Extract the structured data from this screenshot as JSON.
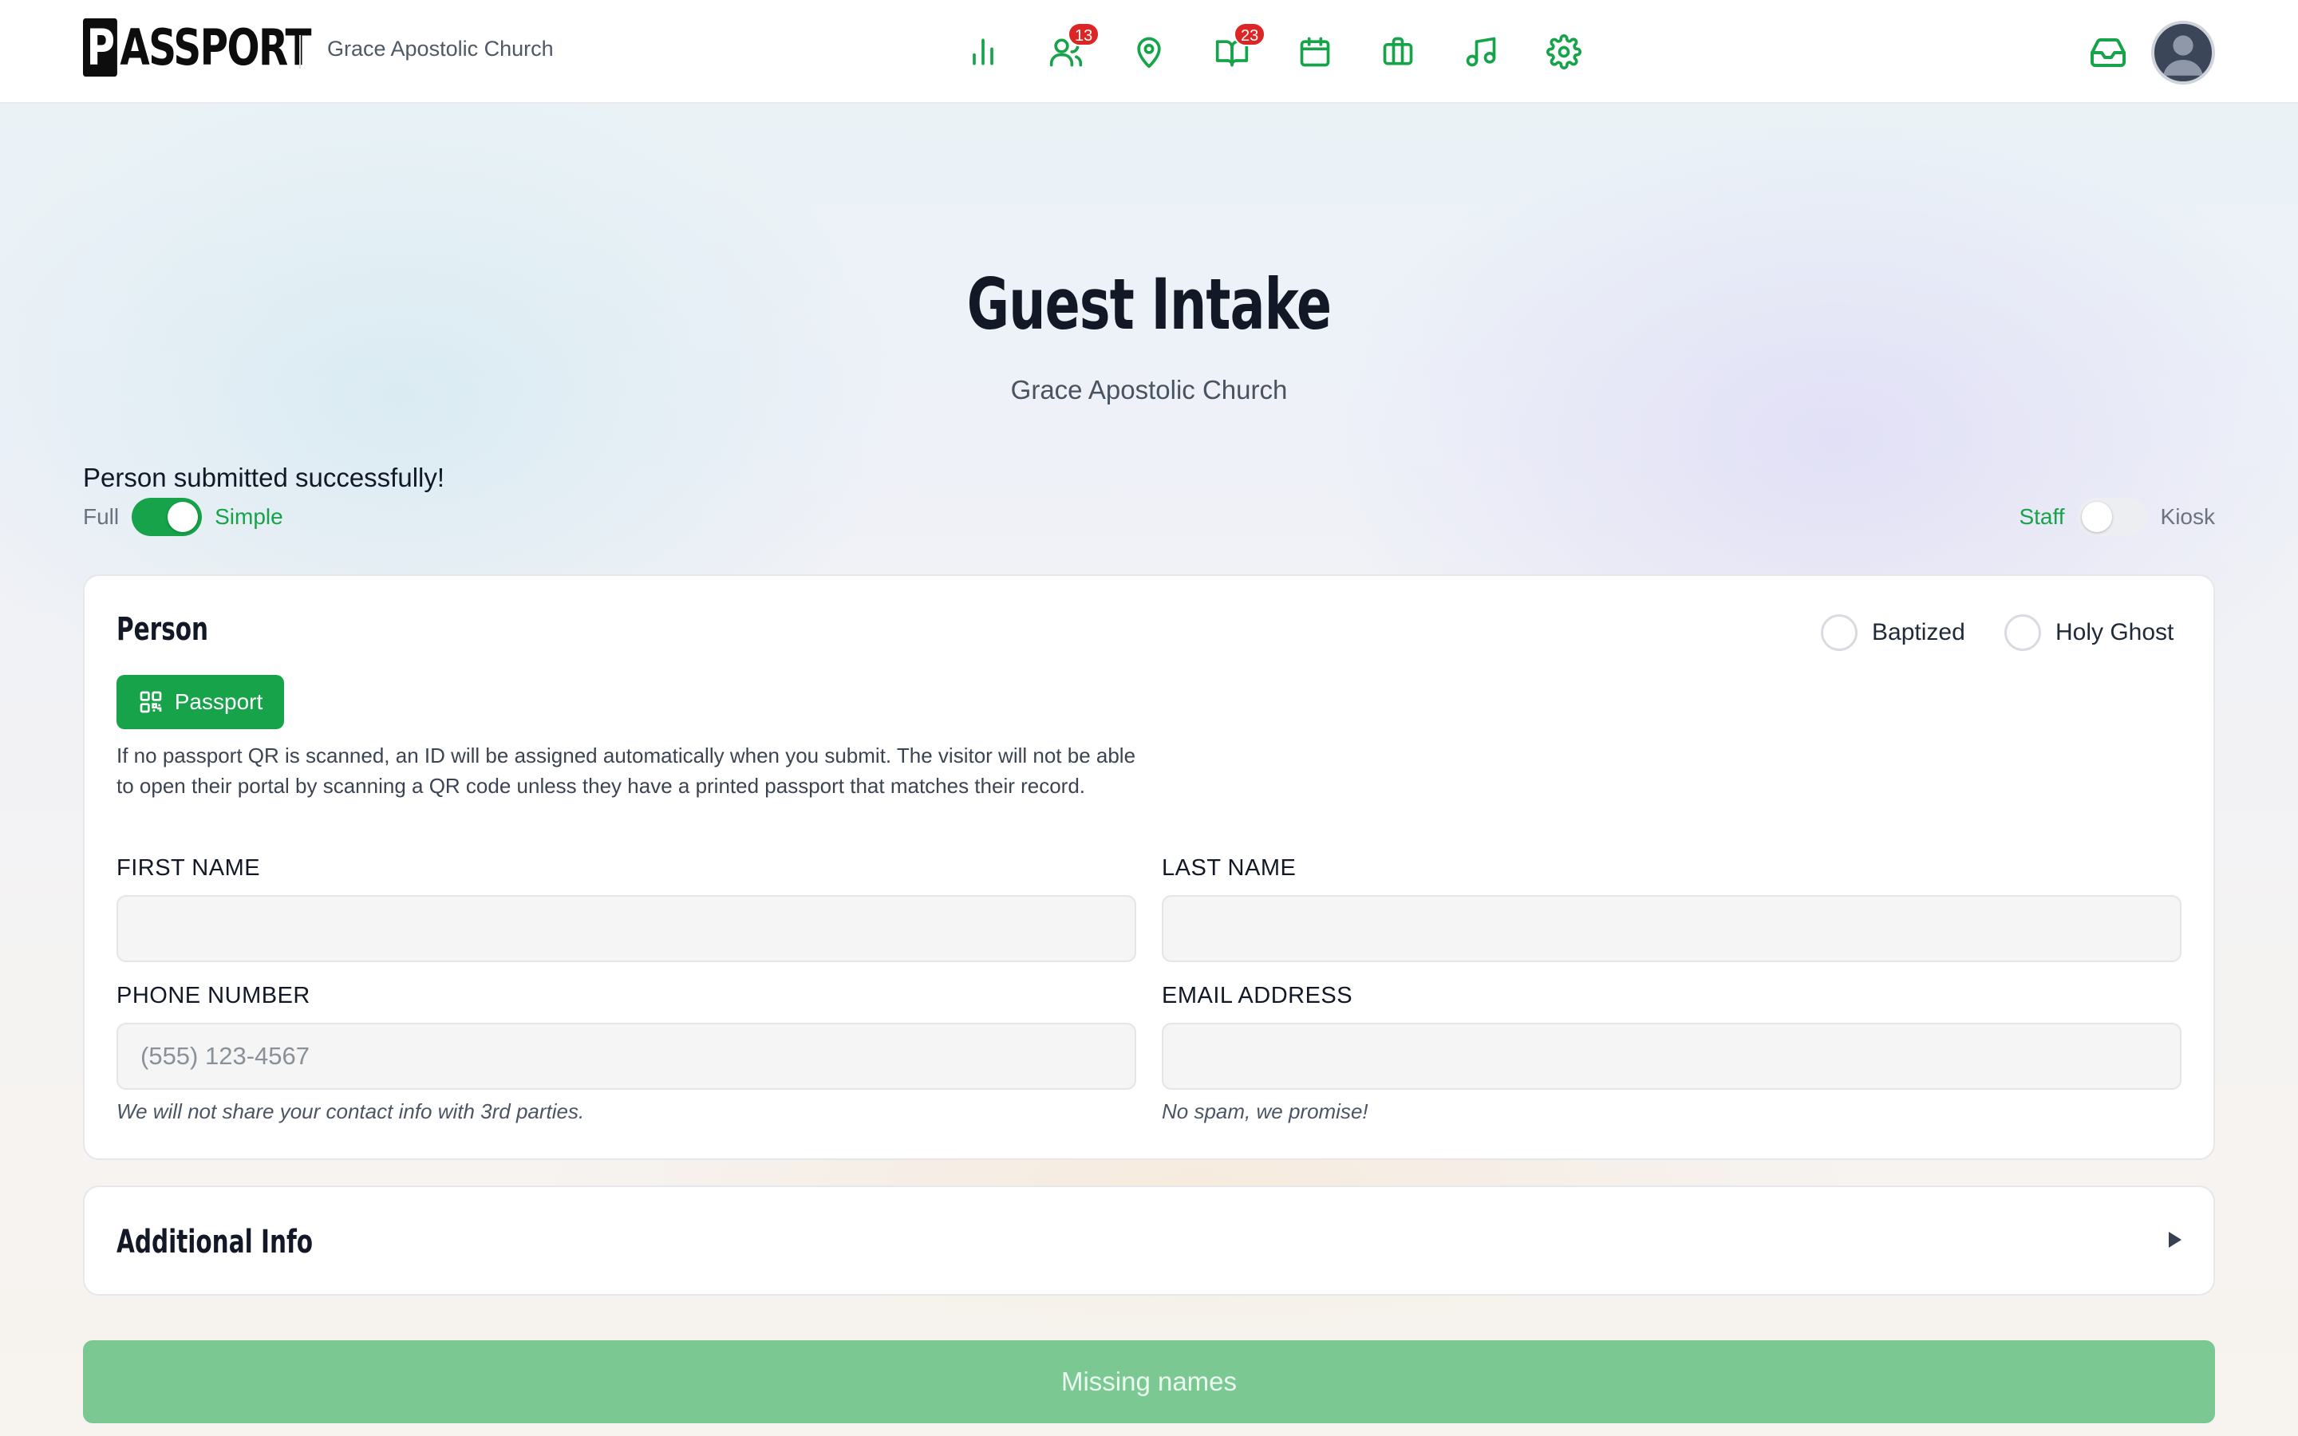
{
  "app": {
    "logo_text": "PASSPORT",
    "logo_first": "P",
    "logo_rest": "ASSPORT",
    "church_name": "Grace Apostolic Church"
  },
  "nav": {
    "icons": [
      {
        "name": "reports-icon",
        "badge": ""
      },
      {
        "name": "people-icon",
        "badge": "13"
      },
      {
        "name": "location-icon",
        "badge": ""
      },
      {
        "name": "book-icon",
        "badge": "23"
      },
      {
        "name": "calendar-icon",
        "badge": ""
      },
      {
        "name": "briefcase-icon",
        "badge": ""
      },
      {
        "name": "music-icon",
        "badge": ""
      },
      {
        "name": "settings-icon",
        "badge": ""
      }
    ],
    "badge_people": "13",
    "badge_book": "23"
  },
  "hero": {
    "title": "Guest Intake",
    "subtitle": "Grace Apostolic Church"
  },
  "status": {
    "message": "Person submitted successfully!"
  },
  "mode_toggle": {
    "left_label": "Full",
    "right_label": "Simple",
    "state": "Simple"
  },
  "view_toggle": {
    "left_label": "Staff",
    "right_label": "Kiosk",
    "state": "Staff"
  },
  "person_card": {
    "title": "Person",
    "baptized_label": "Baptized",
    "holy_ghost_label": "Holy Ghost",
    "passport_button": "Passport",
    "info": "If no passport QR is scanned, an ID will be assigned automatically when you submit. The visitor will not be able to open their portal by scanning a QR code unless they have a printed passport that matches their record.",
    "first_name_label": "FIRST NAME",
    "first_name_value": "",
    "last_name_label": "LAST NAME",
    "last_name_value": "",
    "phone_label": "PHONE NUMBER",
    "phone_placeholder": "(555) 123-4567",
    "phone_help": "We will not share your contact info with 3rd parties.",
    "email_label": "EMAIL ADDRESS",
    "email_value": "",
    "email_help": "No spam, we promise!"
  },
  "additional_card": {
    "title": "Additional Info"
  },
  "submit": {
    "label": "Missing names"
  },
  "colors": {
    "accent": "#16a34a",
    "badge": "#dc2626",
    "submit_disabled": "#7cc892"
  }
}
